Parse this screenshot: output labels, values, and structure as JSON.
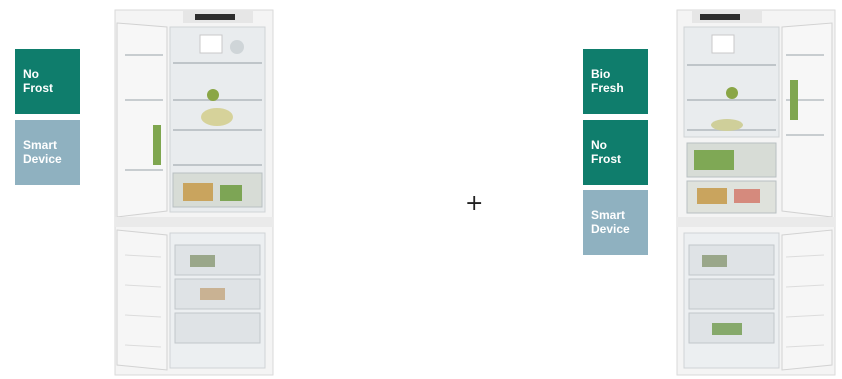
{
  "left": {
    "badges": [
      {
        "line1": "No",
        "line2": "Frost",
        "color": "#0f7d6c"
      },
      {
        "line1": "Smart",
        "line2": "Device",
        "color": "#8fb1c0"
      }
    ]
  },
  "combine_symbol": "+",
  "right": {
    "badges": [
      {
        "line1": "Bio",
        "line2": "Fresh",
        "color": "#0f7d6c"
      },
      {
        "line1": "No",
        "line2": "Frost",
        "color": "#0f7d6c"
      },
      {
        "line1": "Smart",
        "line2": "Device",
        "color": "#8fb1c0"
      }
    ]
  },
  "images": [
    {
      "icon": "fridge-freezer-open-left-image"
    },
    {
      "icon": "fridge-freezer-open-right-image"
    }
  ]
}
